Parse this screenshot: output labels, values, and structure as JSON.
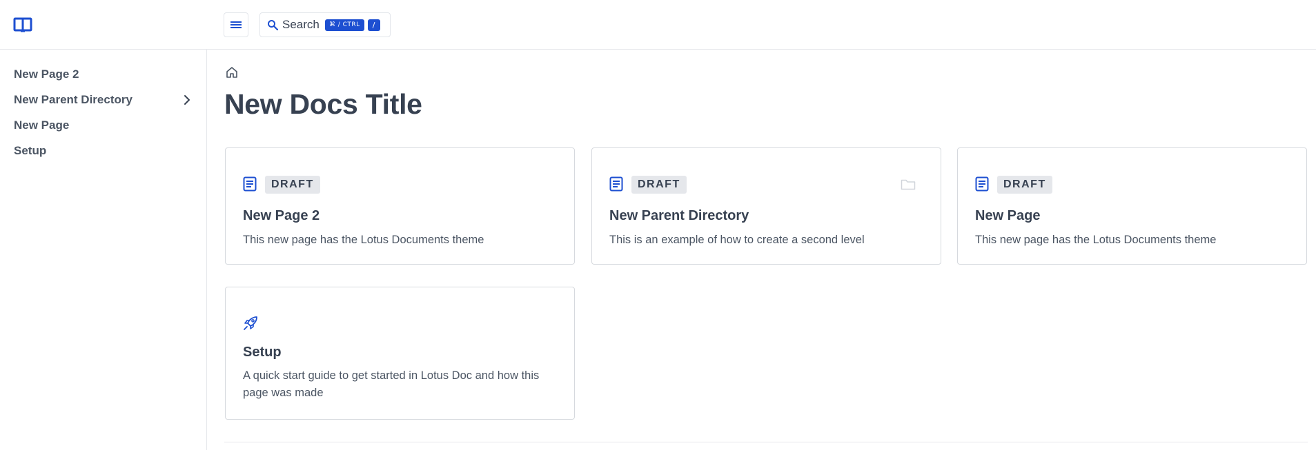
{
  "header": {
    "logo_icon": "open-book-icon",
    "menu_icon": "hamburger-menu-icon",
    "search": {
      "label": "Search",
      "icon": "magnifier-icon",
      "shortcut_modifier": "⌘ / CTRL",
      "shortcut_key": "/"
    }
  },
  "sidebar": {
    "items": [
      {
        "label": "New Page 2",
        "has_children": false
      },
      {
        "label": "New Parent Directory",
        "has_children": true,
        "chevron_icon": "chevron-right-icon"
      },
      {
        "label": "New Page",
        "has_children": false
      },
      {
        "label": "Setup",
        "has_children": false
      }
    ]
  },
  "main": {
    "breadcrumb_icon": "home-icon",
    "title": "New Docs Title",
    "cards": [
      {
        "icon": "document-lines-icon",
        "badge": "DRAFT",
        "title": "New Page 2",
        "description": "This new page has the Lotus Documents theme"
      },
      {
        "icon": "document-lines-icon",
        "badge": "DRAFT",
        "secondary_icon": "folder-icon",
        "title": "New Parent Directory",
        "description": "This is an example of how to create a second level"
      },
      {
        "icon": "document-lines-icon",
        "badge": "DRAFT",
        "title": "New Page",
        "description": "This new page has the Lotus Documents theme"
      },
      {
        "icon": "rocket-icon",
        "title": "Setup",
        "description": "A quick start guide to get started in Lotus Doc and how this page was made"
      }
    ]
  },
  "colors": {
    "accent": "#1d4fd1",
    "text": "#374151",
    "muted_text": "#4b5563",
    "border": "#d6d9de",
    "badge_bg": "#e5e7eb",
    "folder_icon": "#d1d5db"
  }
}
